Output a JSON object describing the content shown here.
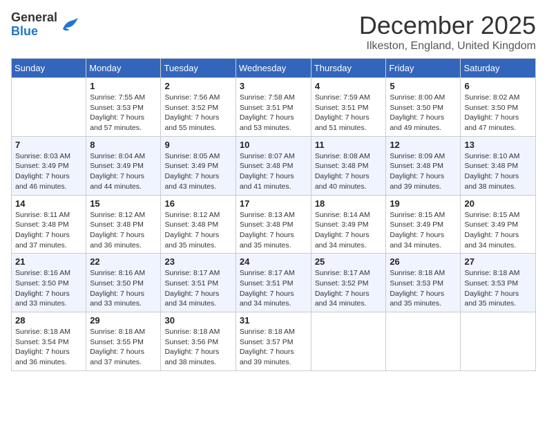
{
  "logo": {
    "general": "General",
    "blue": "Blue"
  },
  "title": "December 2025",
  "location": "Ilkeston, England, United Kingdom",
  "days_of_week": [
    "Sunday",
    "Monday",
    "Tuesday",
    "Wednesday",
    "Thursday",
    "Friday",
    "Saturday"
  ],
  "weeks": [
    [
      {
        "day": "",
        "info": ""
      },
      {
        "day": "1",
        "info": "Sunrise: 7:55 AM\nSunset: 3:53 PM\nDaylight: 7 hours\nand 57 minutes."
      },
      {
        "day": "2",
        "info": "Sunrise: 7:56 AM\nSunset: 3:52 PM\nDaylight: 7 hours\nand 55 minutes."
      },
      {
        "day": "3",
        "info": "Sunrise: 7:58 AM\nSunset: 3:51 PM\nDaylight: 7 hours\nand 53 minutes."
      },
      {
        "day": "4",
        "info": "Sunrise: 7:59 AM\nSunset: 3:51 PM\nDaylight: 7 hours\nand 51 minutes."
      },
      {
        "day": "5",
        "info": "Sunrise: 8:00 AM\nSunset: 3:50 PM\nDaylight: 7 hours\nand 49 minutes."
      },
      {
        "day": "6",
        "info": "Sunrise: 8:02 AM\nSunset: 3:50 PM\nDaylight: 7 hours\nand 47 minutes."
      }
    ],
    [
      {
        "day": "7",
        "info": "Sunrise: 8:03 AM\nSunset: 3:49 PM\nDaylight: 7 hours\nand 46 minutes."
      },
      {
        "day": "8",
        "info": "Sunrise: 8:04 AM\nSunset: 3:49 PM\nDaylight: 7 hours\nand 44 minutes."
      },
      {
        "day": "9",
        "info": "Sunrise: 8:05 AM\nSunset: 3:49 PM\nDaylight: 7 hours\nand 43 minutes."
      },
      {
        "day": "10",
        "info": "Sunrise: 8:07 AM\nSunset: 3:48 PM\nDaylight: 7 hours\nand 41 minutes."
      },
      {
        "day": "11",
        "info": "Sunrise: 8:08 AM\nSunset: 3:48 PM\nDaylight: 7 hours\nand 40 minutes."
      },
      {
        "day": "12",
        "info": "Sunrise: 8:09 AM\nSunset: 3:48 PM\nDaylight: 7 hours\nand 39 minutes."
      },
      {
        "day": "13",
        "info": "Sunrise: 8:10 AM\nSunset: 3:48 PM\nDaylight: 7 hours\nand 38 minutes."
      }
    ],
    [
      {
        "day": "14",
        "info": "Sunrise: 8:11 AM\nSunset: 3:48 PM\nDaylight: 7 hours\nand 37 minutes."
      },
      {
        "day": "15",
        "info": "Sunrise: 8:12 AM\nSunset: 3:48 PM\nDaylight: 7 hours\nand 36 minutes."
      },
      {
        "day": "16",
        "info": "Sunrise: 8:12 AM\nSunset: 3:48 PM\nDaylight: 7 hours\nand 35 minutes."
      },
      {
        "day": "17",
        "info": "Sunrise: 8:13 AM\nSunset: 3:48 PM\nDaylight: 7 hours\nand 35 minutes."
      },
      {
        "day": "18",
        "info": "Sunrise: 8:14 AM\nSunset: 3:49 PM\nDaylight: 7 hours\nand 34 minutes."
      },
      {
        "day": "19",
        "info": "Sunrise: 8:15 AM\nSunset: 3:49 PM\nDaylight: 7 hours\nand 34 minutes."
      },
      {
        "day": "20",
        "info": "Sunrise: 8:15 AM\nSunset: 3:49 PM\nDaylight: 7 hours\nand 34 minutes."
      }
    ],
    [
      {
        "day": "21",
        "info": "Sunrise: 8:16 AM\nSunset: 3:50 PM\nDaylight: 7 hours\nand 33 minutes."
      },
      {
        "day": "22",
        "info": "Sunrise: 8:16 AM\nSunset: 3:50 PM\nDaylight: 7 hours\nand 33 minutes."
      },
      {
        "day": "23",
        "info": "Sunrise: 8:17 AM\nSunset: 3:51 PM\nDaylight: 7 hours\nand 34 minutes."
      },
      {
        "day": "24",
        "info": "Sunrise: 8:17 AM\nSunset: 3:51 PM\nDaylight: 7 hours\nand 34 minutes."
      },
      {
        "day": "25",
        "info": "Sunrise: 8:17 AM\nSunset: 3:52 PM\nDaylight: 7 hours\nand 34 minutes."
      },
      {
        "day": "26",
        "info": "Sunrise: 8:18 AM\nSunset: 3:53 PM\nDaylight: 7 hours\nand 35 minutes."
      },
      {
        "day": "27",
        "info": "Sunrise: 8:18 AM\nSunset: 3:53 PM\nDaylight: 7 hours\nand 35 minutes."
      }
    ],
    [
      {
        "day": "28",
        "info": "Sunrise: 8:18 AM\nSunset: 3:54 PM\nDaylight: 7 hours\nand 36 minutes."
      },
      {
        "day": "29",
        "info": "Sunrise: 8:18 AM\nSunset: 3:55 PM\nDaylight: 7 hours\nand 37 minutes."
      },
      {
        "day": "30",
        "info": "Sunrise: 8:18 AM\nSunset: 3:56 PM\nDaylight: 7 hours\nand 38 minutes."
      },
      {
        "day": "31",
        "info": "Sunrise: 8:18 AM\nSunset: 3:57 PM\nDaylight: 7 hours\nand 39 minutes."
      },
      {
        "day": "",
        "info": ""
      },
      {
        "day": "",
        "info": ""
      },
      {
        "day": "",
        "info": ""
      }
    ]
  ]
}
